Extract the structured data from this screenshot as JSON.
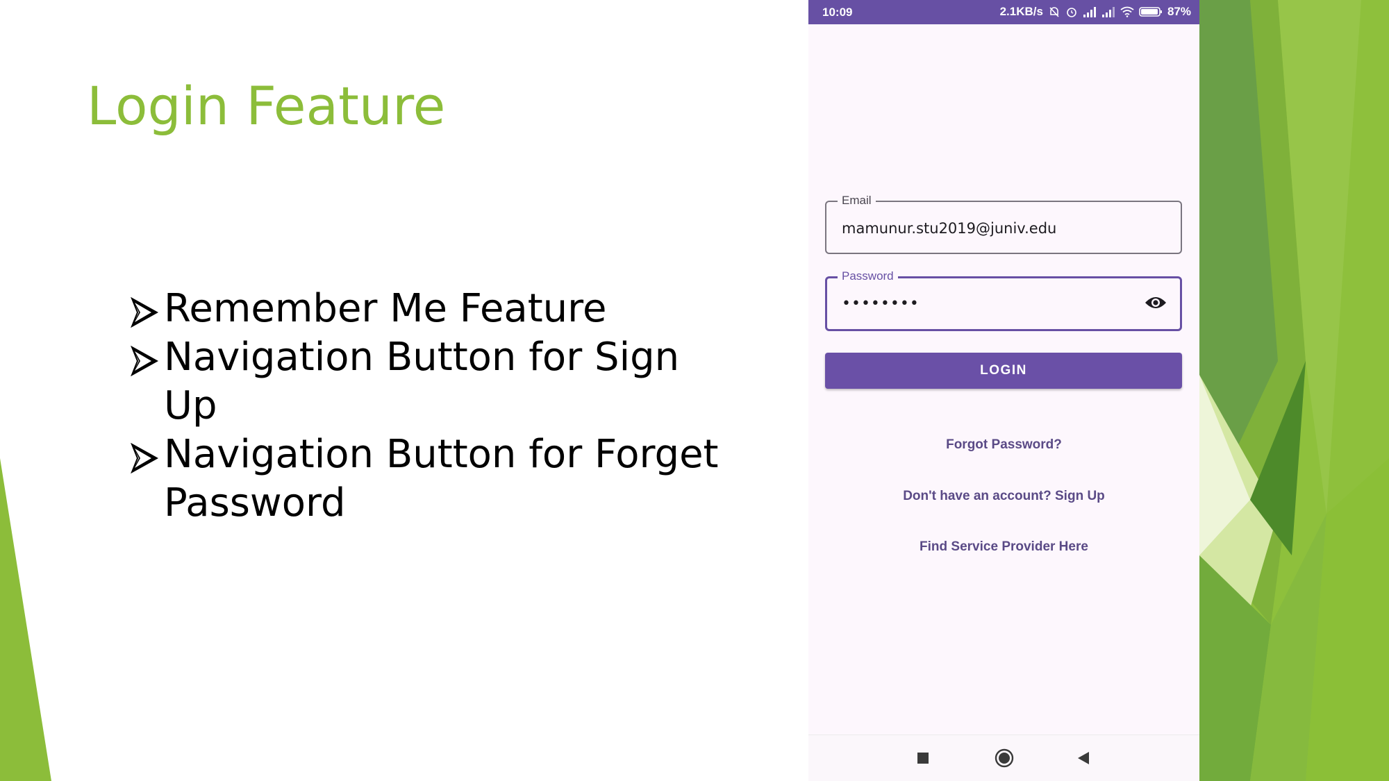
{
  "slide": {
    "title": "Login Feature",
    "bullets": [
      "Remember Me Feature",
      "Navigation Button for Sign Up",
      "Navigation Button for Forget Password"
    ],
    "accent_color": "#8cbd3a"
  },
  "phone": {
    "status_bar": {
      "time": "10:09",
      "network_speed": "2.1KB/s",
      "battery": "87%",
      "icons": [
        "mute-bell-icon",
        "alarm-icon",
        "signal-icon",
        "signal-icon",
        "wifi-icon",
        "battery-icon"
      ]
    },
    "form": {
      "email_label": "Email",
      "email_value": "mamunur.stu2019@juniv.edu",
      "password_label": "Password",
      "password_value": "••••••••",
      "login_label": "LOGIN"
    },
    "links": {
      "forgot": "Forgot Password?",
      "signup": "Don't have an account? Sign Up",
      "find_provider": "Find Service Provider Here"
    },
    "nav": [
      "recents-square-icon",
      "home-circle-icon",
      "back-triangle-icon"
    ],
    "colors": {
      "primary": "#6750a4",
      "background": "#fdf7fd"
    }
  }
}
